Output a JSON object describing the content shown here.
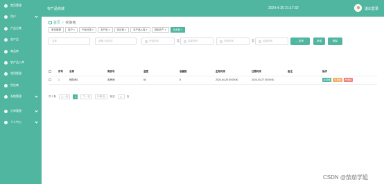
{
  "sidebar": {
    "items": [
      {
        "label": "首页管理",
        "chevron": false
      },
      {
        "label": "用户",
        "chevron": true
      },
      {
        "label": "产品分类",
        "chevron": false
      },
      {
        "label": "农产品",
        "chevron": false
      },
      {
        "label": "商品库",
        "chevron": false
      },
      {
        "label": "农产品入库",
        "chevron": false
      },
      {
        "label": "领用管理",
        "chevron": false
      },
      {
        "label": "供应商",
        "chevron": false
      },
      {
        "label": "系统管理",
        "chevron": true
      },
      {
        "label": "订单管理",
        "chevron": true
      },
      {
        "label": "个人中心",
        "chevron": true
      }
    ]
  },
  "header": {
    "title": "农产品商城",
    "time": "2024-4-25 21:17:32",
    "logout_label": "退出登录"
  },
  "breadcrumb": {
    "home": "首页",
    "current": "农资商"
  },
  "tags": [
    {
      "label": "首页管理",
      "active": false
    },
    {
      "label": "用户 ×",
      "active": false
    },
    {
      "label": "产品分类 ×",
      "active": false
    },
    {
      "label": "农产品 ×",
      "active": false
    },
    {
      "label": "供应商 ×",
      "active": false
    },
    {
      "label": "农产品入库 ×",
      "active": false
    },
    {
      "label": "领用农产 ×",
      "active": false
    },
    {
      "label": "农资商 ×",
      "active": false
    }
  ],
  "filters": {
    "name_placeholder": "名称",
    "location_placeholder": "请输入库存区",
    "start1_placeholder": "开始时间",
    "end1_placeholder": "结束时间",
    "start2_placeholder": "开始时间",
    "end2_placeholder": "结束时间",
    "to_label": "至",
    "search_label": "查询",
    "add_label": "新增",
    "delete_label": "删除"
  },
  "table": {
    "headers": [
      "",
      "序号",
      "名称",
      "库房号",
      "温度",
      "收藏数",
      "生效时间",
      "过期时间",
      "备注",
      "操作"
    ],
    "rows": [
      {
        "index": "1",
        "name": "储存间1",
        "warehouse": "库房间",
        "temp": "50",
        "fav": "5",
        "start": "2024-04-25 00:00:00",
        "end": "2024-04-27 00:00:00",
        "note": ""
      }
    ],
    "ops": {
      "view": "查看",
      "edit": "修改",
      "delete": "删除"
    }
  },
  "pagination": {
    "total": "共 1 条",
    "prev": "上一页",
    "page": "1",
    "next": "下一页",
    "size": "10条/页",
    "goto": "前往",
    "page_input": "1",
    "unit": "页"
  },
  "watermark": "CSDN @茄茄学姐"
}
